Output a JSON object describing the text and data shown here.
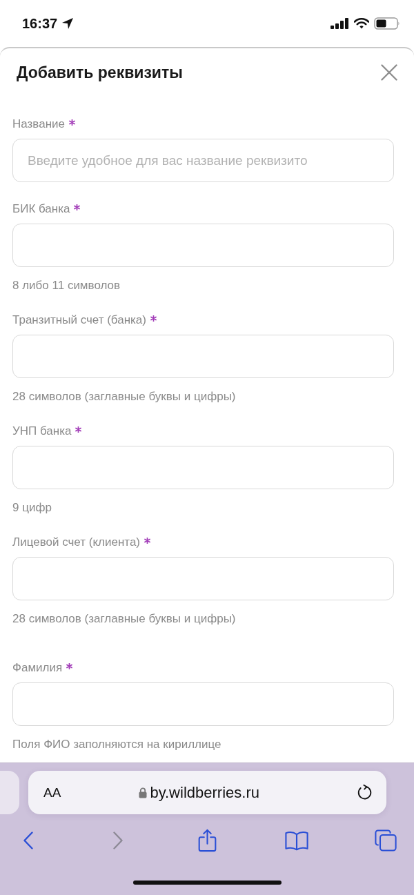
{
  "status_bar": {
    "time": "16:37"
  },
  "sheet": {
    "title": "Добавить реквизиты",
    "sections": [
      {
        "fields": [
          {
            "label": "Название",
            "required": true,
            "placeholder": "Введите удобное для вас название реквизито"
          },
          {
            "label": "БИК банка",
            "required": true,
            "hint": "8 либо 11 символов"
          },
          {
            "label": "Транзитный счет (банка)",
            "required": true,
            "hint": "28 символов (заглавные буквы и цифры)"
          },
          {
            "label": "УНП банка",
            "required": true,
            "hint": "9 цифр"
          },
          {
            "label": "Лицевой счет (клиента)",
            "required": true,
            "hint": "28 символов (заглавные буквы и цифры)"
          }
        ]
      },
      {
        "fields": [
          {
            "label": "Фамилия",
            "required": true,
            "hint": "Поля ФИО заполняются на кириллице"
          }
        ]
      }
    ]
  },
  "browser": {
    "text_size_button": "AA",
    "secure": true,
    "url": "by.wildberries.ru",
    "toolbar": [
      {
        "kind": "back",
        "disabled": false
      },
      {
        "kind": "forward",
        "disabled": true
      },
      {
        "kind": "share",
        "disabled": false
      },
      {
        "kind": "bookmarks",
        "disabled": false
      },
      {
        "kind": "tabs",
        "disabled": false
      }
    ]
  }
}
